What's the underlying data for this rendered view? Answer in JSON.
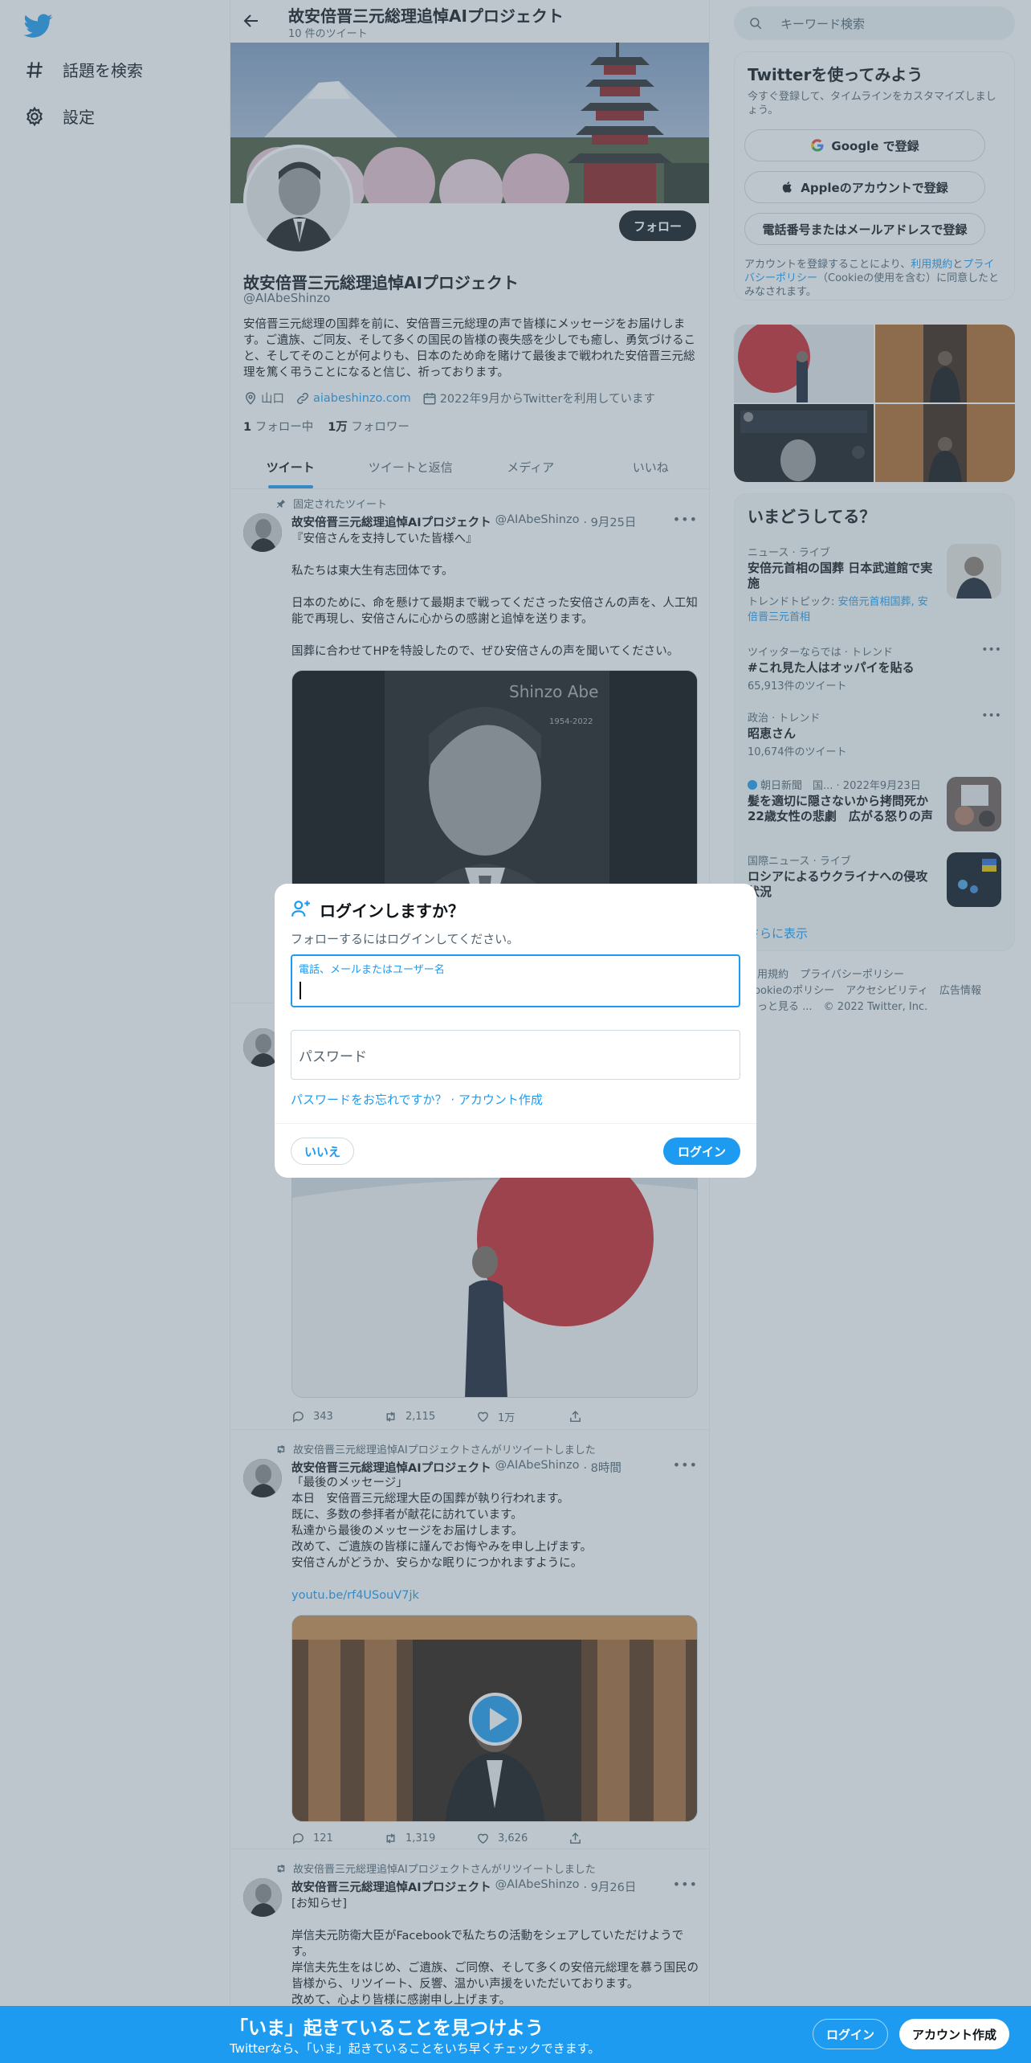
{
  "nav": {
    "explore": "話題を検索",
    "settings": "設定"
  },
  "header": {
    "title": "故安倍晋三元総理追悼AIプロジェクト",
    "tweet_count": "10 件のツイート"
  },
  "profile": {
    "follow_label": "フォロー",
    "name": "故安倍晋三元総理追悼AIプロジェクト",
    "handle": "@AIAbeShinzo",
    "bio": "安倍晋三元総理の国葬を前に、安倍晋三元総理の声で皆様にメッセージをお届けします。ご遺族、ご同友、そして多くの国民の皆様の喪失感を少しでも癒し、勇気づけること、そしてそのことが何よりも、日本のため命を賭けて最後まで戦われた安倍晋三元総理を篤く弔うことになると信じ、祈っております。",
    "location": "山口",
    "website": "aiabeshinzo.com",
    "joined": "2022年9月からTwitterを利用しています",
    "following_count": "1",
    "following_label": "フォロー中",
    "followers_count": "1万",
    "followers_label": "フォロワー"
  },
  "tabs": [
    "ツイート",
    "ツイートと返信",
    "メディア",
    "いいね"
  ],
  "tweets": [
    {
      "context": "固定されたツイート",
      "name": "故安倍晋三元総理追悼AIプロジェクト",
      "handle": "@AIAbeShinzo",
      "time": "· 9月25日",
      "text": "『安倍さんを支持していた皆様へ』\n\n私たちは東大生有志団体です。\n\n日本のために、命を懸けて最期まで戦ってくださった安倍さんの声を、人工知能で再現し、安倍さんに心からの感謝と追悼を送ります。\n\n国葬に合わせてHPを特設したので、ぜひ安倍さんの声を聞いてください。",
      "media_caption_name": "Shinzo Abe",
      "media_caption_years": "1954-2022"
    },
    {
      "replies": "343",
      "retweets": "2,115",
      "likes": "1万"
    },
    {
      "context": "故安倍晋三元総理追悼AIプロジェクトさんがリツイートしました",
      "name": "故安倍晋三元総理追悼AIプロジェクト",
      "handle": "@AIAbeShinzo",
      "time": "· 8時間",
      "text": "「最後のメッセージ」\n本日　安倍晋三元総理大臣の国葬が執り行われます。\n既に、多数の参拝者が献花に訪れています。\n私達から最後のメッセージをお届けします。\n改めて、ご遺族の皆様に謹んでお悔やみを申し上げます。\n安倍さんがどうか、安らかな眠りにつかれますように。",
      "link": "youtu.be/rf4USouV7jk",
      "replies": "121",
      "retweets": "1,319",
      "likes": "3,626"
    },
    {
      "context": "故安倍晋三元総理追悼AIプロジェクトさんがリツイートしました",
      "name": "故安倍晋三元総理追悼AIプロジェクト",
      "handle": "@AIAbeShinzo",
      "time": "· 9月26日",
      "text": "[お知らせ]\n\n岸信夫元防衛大臣がFacebookで私たちの活動をシェアしていただけようです。\n岸信夫先生をはじめ、ご遺族、ご同僚、そして多くの安倍元総理を慕う国民の皆様から、リツイート、反響、温かい声援をいただいております。\n改めて、心より皆様に感謝申し上げます。"
    }
  ],
  "sidebar": {
    "search_placeholder": "キーワード検索",
    "signup_title": "Twitterを使ってみよう",
    "signup_desc": "今すぐ登録して、タイムラインをカスタマイズしましょう。",
    "google_btn": "Google で登録",
    "apple_btn": "Appleのアカウントで登録",
    "phone_btn": "電話番号またはメールアドレスで登録",
    "legal_1": "アカウントを登録することにより、",
    "legal_terms": "利用規約",
    "legal_and": "と",
    "legal_privacy": "プライバシーポリシー",
    "legal_cookie": "（Cookieの使用",
    "legal_2": "を含む）に同意したとみなされます。",
    "trends_title": "いまどうしてる？",
    "trends": [
      {
        "cat": "ニュース · ライブ",
        "name": "安倍元首相の国葬 日本武道館で実施",
        "extra_prefix": "トレンドトピック: ",
        "extra": "安倍元首相国葬, 安倍晋三元首相"
      },
      {
        "cat": "ツイッターならでは · トレンド",
        "name": "#これ見た人はオッパイを貼る",
        "count": "65,913件のツイート"
      },
      {
        "cat": "政治 · トレンド",
        "name": "昭恵さん",
        "count": "10,674件のツイート"
      },
      {
        "cat": "朝日新聞　国... · 2022年9月23日",
        "name": "髪を適切に隠さないから拷問死か　22歳女性の悲劇　広がる怒りの声"
      },
      {
        "cat": "国際ニュース · ライブ",
        "name": "ロシアによるウクライナへの侵攻状況"
      }
    ],
    "show_more": "さらに表示",
    "footer": [
      "利用規約",
      "プライバシーポリシー",
      "Cookieのポリシー",
      "アクセシビリティ",
      "広告情報",
      "もっと見る ...",
      "© 2022 Twitter, Inc."
    ]
  },
  "modal": {
    "title": "ログインしますか？",
    "subtitle": "フォローするにはログインしてください。",
    "field1_label": "電話、メールまたはユーザー名",
    "field2_placeholder": "パスワード",
    "forgot": "パスワードをお忘れですか？",
    "dot": "·",
    "create": "アカウント作成",
    "no_btn": "いいえ",
    "login_btn": "ログイン"
  },
  "bottombar": {
    "title": "「いま」起きていることを見つけよう",
    "subtitle": "Twitterなら、「いま」起きていることをいち早くチェックできます。",
    "login": "ログイン",
    "signup": "アカウント作成"
  },
  "colors": {
    "accent": "#1d9bf0",
    "text": "#0f1419",
    "muted": "#536471"
  }
}
